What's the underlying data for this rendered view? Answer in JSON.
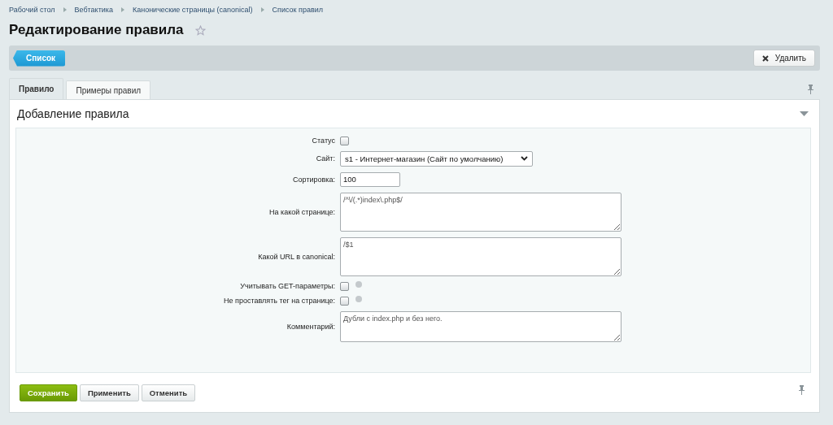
{
  "breadcrumbs": [
    "Рабочий стол",
    "Вебтактика",
    "Канонические страницы (canonical)",
    "Список правил"
  ],
  "title": "Редактирование правила",
  "toolbar": {
    "back_button": "Список",
    "delete_button": "Удалить"
  },
  "tabs": [
    {
      "label": "Правило",
      "selected": true
    },
    {
      "label": "Примеры правил",
      "selected": false
    }
  ],
  "section_title": "Добавление правила",
  "fields": [
    {
      "label": "Статус",
      "kind": "checkbox",
      "checked": false
    },
    {
      "label": "Сайт:",
      "kind": "select",
      "value": "s1 - Интернет-магазин (Сайт по умолчанию)"
    },
    {
      "label": "Сортировка:",
      "kind": "input",
      "value": "100"
    },
    {
      "label": "На какой странице:",
      "kind": "textarea",
      "value": "/^\\/(.*)index\\.php$/"
    },
    {
      "label": "Какой URL в canonical:",
      "kind": "textarea",
      "value": "/$1"
    },
    {
      "label": "Учитывать GET-параметры:",
      "kind": "checkbox-help",
      "checked": false
    },
    {
      "label": "Не проставлять тег на странице:",
      "kind": "checkbox-help",
      "checked": false
    },
    {
      "label": "Комментарий:",
      "kind": "comment",
      "value": "Дубли с index.php и без него."
    }
  ],
  "buttons": [
    {
      "label": "Сохранить",
      "kind": "primary"
    },
    {
      "label": "Применить",
      "kind": "default"
    },
    {
      "label": "Отменить",
      "kind": "default"
    }
  ]
}
